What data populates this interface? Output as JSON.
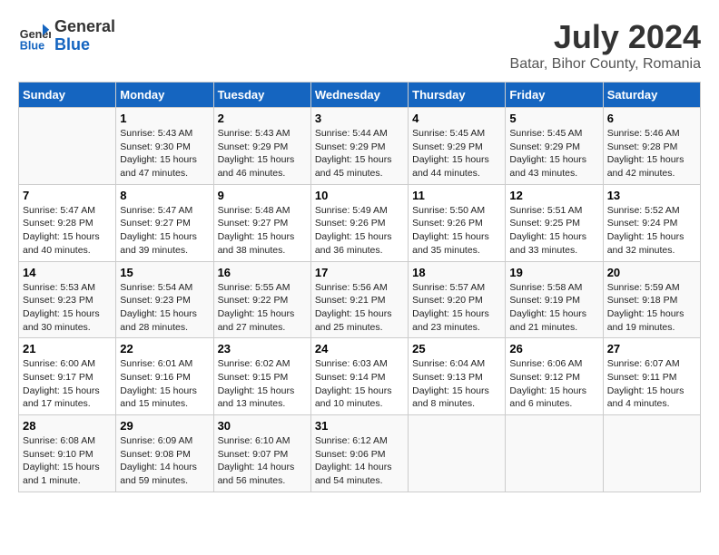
{
  "logo": {
    "line1": "General",
    "line2": "Blue"
  },
  "title": "July 2024",
  "subtitle": "Batar, Bihor County, Romania",
  "days_of_week": [
    "Sunday",
    "Monday",
    "Tuesday",
    "Wednesday",
    "Thursday",
    "Friday",
    "Saturday"
  ],
  "weeks": [
    [
      {
        "day": "",
        "info": ""
      },
      {
        "day": "1",
        "info": "Sunrise: 5:43 AM\nSunset: 9:30 PM\nDaylight: 15 hours\nand 47 minutes."
      },
      {
        "day": "2",
        "info": "Sunrise: 5:43 AM\nSunset: 9:29 PM\nDaylight: 15 hours\nand 46 minutes."
      },
      {
        "day": "3",
        "info": "Sunrise: 5:44 AM\nSunset: 9:29 PM\nDaylight: 15 hours\nand 45 minutes."
      },
      {
        "day": "4",
        "info": "Sunrise: 5:45 AM\nSunset: 9:29 PM\nDaylight: 15 hours\nand 44 minutes."
      },
      {
        "day": "5",
        "info": "Sunrise: 5:45 AM\nSunset: 9:29 PM\nDaylight: 15 hours\nand 43 minutes."
      },
      {
        "day": "6",
        "info": "Sunrise: 5:46 AM\nSunset: 9:28 PM\nDaylight: 15 hours\nand 42 minutes."
      }
    ],
    [
      {
        "day": "7",
        "info": "Sunrise: 5:47 AM\nSunset: 9:28 PM\nDaylight: 15 hours\nand 40 minutes."
      },
      {
        "day": "8",
        "info": "Sunrise: 5:47 AM\nSunset: 9:27 PM\nDaylight: 15 hours\nand 39 minutes."
      },
      {
        "day": "9",
        "info": "Sunrise: 5:48 AM\nSunset: 9:27 PM\nDaylight: 15 hours\nand 38 minutes."
      },
      {
        "day": "10",
        "info": "Sunrise: 5:49 AM\nSunset: 9:26 PM\nDaylight: 15 hours\nand 36 minutes."
      },
      {
        "day": "11",
        "info": "Sunrise: 5:50 AM\nSunset: 9:26 PM\nDaylight: 15 hours\nand 35 minutes."
      },
      {
        "day": "12",
        "info": "Sunrise: 5:51 AM\nSunset: 9:25 PM\nDaylight: 15 hours\nand 33 minutes."
      },
      {
        "day": "13",
        "info": "Sunrise: 5:52 AM\nSunset: 9:24 PM\nDaylight: 15 hours\nand 32 minutes."
      }
    ],
    [
      {
        "day": "14",
        "info": "Sunrise: 5:53 AM\nSunset: 9:23 PM\nDaylight: 15 hours\nand 30 minutes."
      },
      {
        "day": "15",
        "info": "Sunrise: 5:54 AM\nSunset: 9:23 PM\nDaylight: 15 hours\nand 28 minutes."
      },
      {
        "day": "16",
        "info": "Sunrise: 5:55 AM\nSunset: 9:22 PM\nDaylight: 15 hours\nand 27 minutes."
      },
      {
        "day": "17",
        "info": "Sunrise: 5:56 AM\nSunset: 9:21 PM\nDaylight: 15 hours\nand 25 minutes."
      },
      {
        "day": "18",
        "info": "Sunrise: 5:57 AM\nSunset: 9:20 PM\nDaylight: 15 hours\nand 23 minutes."
      },
      {
        "day": "19",
        "info": "Sunrise: 5:58 AM\nSunset: 9:19 PM\nDaylight: 15 hours\nand 21 minutes."
      },
      {
        "day": "20",
        "info": "Sunrise: 5:59 AM\nSunset: 9:18 PM\nDaylight: 15 hours\nand 19 minutes."
      }
    ],
    [
      {
        "day": "21",
        "info": "Sunrise: 6:00 AM\nSunset: 9:17 PM\nDaylight: 15 hours\nand 17 minutes."
      },
      {
        "day": "22",
        "info": "Sunrise: 6:01 AM\nSunset: 9:16 PM\nDaylight: 15 hours\nand 15 minutes."
      },
      {
        "day": "23",
        "info": "Sunrise: 6:02 AM\nSunset: 9:15 PM\nDaylight: 15 hours\nand 13 minutes."
      },
      {
        "day": "24",
        "info": "Sunrise: 6:03 AM\nSunset: 9:14 PM\nDaylight: 15 hours\nand 10 minutes."
      },
      {
        "day": "25",
        "info": "Sunrise: 6:04 AM\nSunset: 9:13 PM\nDaylight: 15 hours\nand 8 minutes."
      },
      {
        "day": "26",
        "info": "Sunrise: 6:06 AM\nSunset: 9:12 PM\nDaylight: 15 hours\nand 6 minutes."
      },
      {
        "day": "27",
        "info": "Sunrise: 6:07 AM\nSunset: 9:11 PM\nDaylight: 15 hours\nand 4 minutes."
      }
    ],
    [
      {
        "day": "28",
        "info": "Sunrise: 6:08 AM\nSunset: 9:10 PM\nDaylight: 15 hours\nand 1 minute."
      },
      {
        "day": "29",
        "info": "Sunrise: 6:09 AM\nSunset: 9:08 PM\nDaylight: 14 hours\nand 59 minutes."
      },
      {
        "day": "30",
        "info": "Sunrise: 6:10 AM\nSunset: 9:07 PM\nDaylight: 14 hours\nand 56 minutes."
      },
      {
        "day": "31",
        "info": "Sunrise: 6:12 AM\nSunset: 9:06 PM\nDaylight: 14 hours\nand 54 minutes."
      },
      {
        "day": "",
        "info": ""
      },
      {
        "day": "",
        "info": ""
      },
      {
        "day": "",
        "info": ""
      }
    ]
  ]
}
